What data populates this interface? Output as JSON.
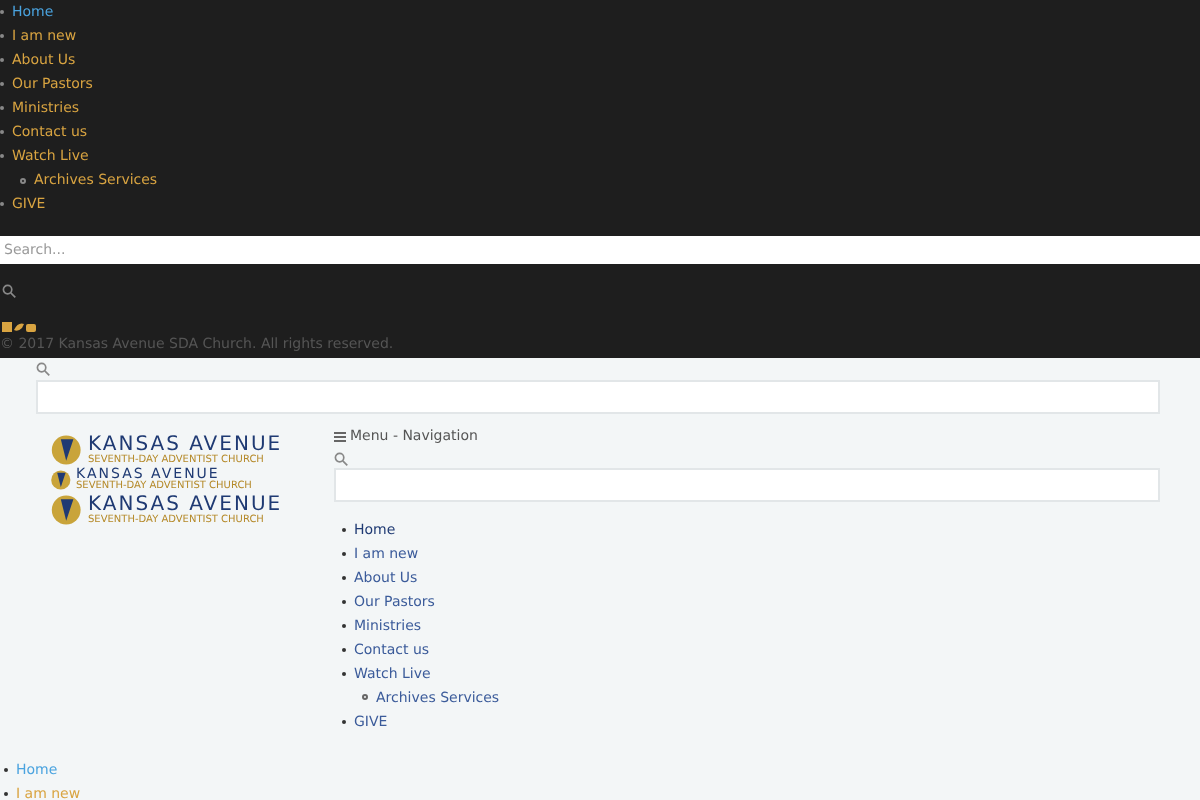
{
  "top_menu": {
    "items": [
      {
        "label": "Home",
        "selected": true
      },
      {
        "label": "I am new",
        "selected": false
      },
      {
        "label": "About Us",
        "selected": false
      },
      {
        "label": "Our Pastors",
        "selected": false
      },
      {
        "label": "Ministries",
        "selected": false
      },
      {
        "label": "Contact us",
        "selected": false
      },
      {
        "label": "Watch Live",
        "selected": false,
        "children": [
          {
            "label": "Archives Services",
            "selected": false
          }
        ]
      },
      {
        "label": "GIVE",
        "selected": false
      }
    ]
  },
  "top_search": {
    "placeholder": "Search..."
  },
  "footer": {
    "copyright": "© 2017 Kansas Avenue SDA Church. All rights reserved."
  },
  "header_logos": [
    {
      "name": "KANSAS AVENUE",
      "tagline": "SEVENTH-DAY ADVENTIST CHURCH"
    },
    {
      "name": "KANSAS AVENUE",
      "tagline": "SEVENTH-DAY ADVENTIST CHURCH"
    },
    {
      "name": "KANSAS AVENUE",
      "tagline": "SEVENTH-DAY ADVENTIST CHURCH"
    }
  ],
  "nav": {
    "title": "Menu - Navigation",
    "items": [
      {
        "label": "Home",
        "selected": true
      },
      {
        "label": "I am new",
        "selected": false
      },
      {
        "label": "About Us",
        "selected": false
      },
      {
        "label": "Our Pastors",
        "selected": false
      },
      {
        "label": "Ministries",
        "selected": false
      },
      {
        "label": "Contact us",
        "selected": false
      },
      {
        "label": "Watch Live",
        "selected": false,
        "children": [
          {
            "label": "Archives Services",
            "selected": false
          }
        ]
      },
      {
        "label": "GIVE",
        "selected": false
      }
    ]
  },
  "bottom_menu": {
    "items": [
      {
        "label": "Home",
        "selected": true
      },
      {
        "label": "I am new",
        "selected": false
      }
    ]
  }
}
